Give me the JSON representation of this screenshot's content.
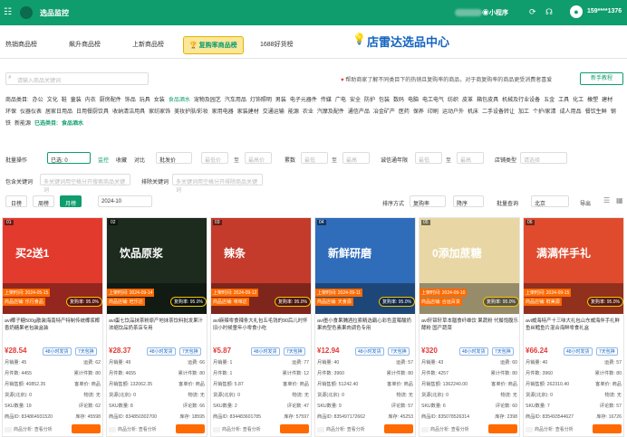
{
  "topbar": {
    "title": "选品监控",
    "mini_program": "小程序",
    "phone": "159****1376",
    "color": "#0f9d6e"
  },
  "tabs": [
    {
      "label": "热销商品榜"
    },
    {
      "label": "飙升商品榜"
    },
    {
      "label": "上新商品榜"
    },
    {
      "label": "复购率商品榜",
      "active": true
    },
    {
      "label": "1688好货榜"
    }
  ],
  "brand_text": "店雷达选品中心",
  "search": {
    "placeholder": "请输入商品关键词"
  },
  "notice": {
    "prefix": "帮助商家了解不同类目下的热销且复购率的商品，对于商复购率的商品更受消费者喜爱"
  },
  "tutor_button": "新手教程",
  "categories": {
    "label": "商品类目:",
    "items": [
      "办公",
      "文化",
      "鞋",
      "童装",
      "内衣",
      "厨房配件",
      "饰品",
      "玩具",
      "女装",
      "食品酒水",
      "宠物及园艺",
      "汽车用品",
      "灯饰照明",
      "男装",
      "电子元器件",
      "传媒",
      "广电",
      "安全",
      "防护",
      "包装",
      "数码",
      "电脑",
      "电工电气",
      "纺织",
      "皮革",
      "箱包皮具",
      "机械及行业设备",
      "五金",
      "工具",
      "化工",
      "橡塑",
      "建材",
      "环保",
      "仪器仪表",
      "居家日用品",
      "日用餐厨饮具",
      "收纳清洁用具",
      "家纺家饰",
      "美妆护肤/彩妆",
      "家用电器",
      "家装建材",
      "交通运输",
      "能源",
      "农业",
      "汽摩及配件",
      "通信产品",
      "冶金矿产",
      "医药",
      "保养",
      "印刷",
      "运动户外",
      "机床",
      "二手设备转让",
      "加工",
      "个护/家清",
      "成人用品",
      "餐饮生鲜",
      "钢铁",
      "新能源"
    ],
    "current_label": "已选类目:",
    "current_value": "食品酒水"
  },
  "filters": {
    "batch_label": "批量操作",
    "selected_box": "已选: 0",
    "btn_monitor": "监控",
    "btn_collect": "收藏",
    "btn_compare": "对比",
    "batch_sel": "批发价",
    "min_price": "最低价",
    "to": "至",
    "max_price": "最高价",
    "deal_label": "订单量(近30天)",
    "min_deal": "最低",
    "max_deal": "最高",
    "score_label": "累数",
    "min_score": "最低",
    "max_score": "最高",
    "tenure_label": "诚信通年限",
    "min_ten": "最低",
    "max_ten": "最高",
    "shop_type_label": "店铺类型",
    "shop_type_sel": "请选择",
    "include_label": "包含关键词",
    "include_ph": "多关键词用空格分开搜索商品关键词",
    "exclude_label": "排除关键词",
    "exclude_ph": "多关键词用空格分开排除商品关键词"
  },
  "period": {
    "daily": "日榜",
    "weekly": "周榜",
    "monthly": "月榜",
    "month_value": "2024-10",
    "sort_label": "排序方式",
    "sort_value": "复购率",
    "order_value": "降序",
    "batch_query": "批量查询",
    "region": "北京",
    "export": "导出"
  },
  "products": [
    {
      "num": "01",
      "img_color": "#e23b2e",
      "img_word": "买2送1",
      "date": "上架时间: 2024-05-15",
      "shop": "商品店铺: 乐行食品",
      "rate": "复购率: 95.0%",
      "title": "avi椰子糖500g散装海南特产特制传统椰浆椰香奶糖果老包装盒装",
      "price": "¥28.54",
      "tag1": "48小时发货",
      "tag2": "7天包换",
      "rows": [
        [
          "月销量: 45",
          "运费: 62"
        ],
        [
          "月件数: 4455",
          "累计件数: 80"
        ],
        [
          "月销售额: 40852.35",
          "客单价: 商品"
        ],
        [
          "货源(北京): 0",
          "物流: 无"
        ],
        [
          "SKU数量: 19",
          "评论数: 62"
        ],
        [
          "商品ID: 834864931520",
          "库存: 45598"
        ]
      ],
      "foot": "商品分析: 查看分析"
    },
    {
      "num": "02",
      "img_color": "#1d2a1e",
      "img_word": "饮品原浆",
      "date": "上架时间: 2024-09-14",
      "shop": "商品店铺: 旺乐达",
      "rate": "复购率: 95.0%",
      "title": "avi蛋七饮品抹茶粉原产地抹茶饮料批发果汁浓缩饮品奶茶店专用",
      "price": "¥28.37",
      "tag1": "48小时发货",
      "tag2": "7天包换",
      "rows": [
        [
          "月销量: 49",
          "运费: 66"
        ],
        [
          "月件数: 4655",
          "累计件数: 80"
        ],
        [
          "月销售额: 132062.35",
          "客单价: 商品"
        ],
        [
          "货源(北京): 0",
          "物流: 无"
        ],
        [
          "SKU数量: 8",
          "评论数: 66"
        ],
        [
          "商品ID: 834850302700",
          "库存: 18595"
        ]
      ],
      "foot": "商品分析: 查看分析"
    },
    {
      "num": "03",
      "img_color": "#c43b2c",
      "img_word": "辣条",
      "date": "上架时间: 2024-09-12",
      "shop": "商品店铺: 味味达",
      "rate": "复购率: 95.0%",
      "title": "avi麻辣零食辣条大礼包五毛钱的90后儿时怀旧小时候童年小零食小吃",
      "price": "¥5.87",
      "tag1": "48小时发货",
      "tag2": "7天包换",
      "rows": [
        [
          "月销量: 1",
          "运费: 77"
        ],
        [
          "月件数: 1",
          "累计件数: 12"
        ],
        [
          "月销售额: 5.87",
          "客单价: 商品"
        ],
        [
          "货源(北京): 0",
          "物流: 无"
        ],
        [
          "SKU数量: 2",
          "评论数: 47"
        ],
        [
          "商品ID: 834483601785",
          "库存: 57597"
        ]
      ],
      "foot": "商品分析: 查看分析"
    },
    {
      "num": "04",
      "img_color": "#2f6dbb",
      "img_word": "新鲜研磨",
      "date": "上架时间: 2024-09-11",
      "shop": "商品店铺: 天食源",
      "rate": "复购率: 95.0%",
      "title": "avi墨小食果脯酒拉索精选霸心彩色蓝莓酸奶果肉型色素果肉调色专用",
      "price": "¥12.94",
      "tag1": "48小时发货",
      "tag2": "7天包换",
      "rows": [
        [
          "月销量: 40",
          "运费: 57"
        ],
        [
          "月件数: 3960",
          "累计件数: 80"
        ],
        [
          "月销售额: 51242.40",
          "客单价: 商品"
        ],
        [
          "货源(北京): 0",
          "物流: 无"
        ],
        [
          "SKU数量: 9",
          "评论数: 57"
        ],
        [
          "商品ID: 835497172662",
          "库存: 45253"
        ]
      ],
      "foot": "商品分析: 查看分析"
    },
    {
      "num": "05",
      "img_color": "#e8d7a4",
      "img_word": "0添加蔗糖",
      "date": "上架时间: 2024-09-10",
      "shop": "商品店铺: 合运百货",
      "rate": "复购率: 95.0%",
      "title": "avi轩锦轩草本膳食纤维饮 果蔬粉 代餐饱腹乐酵粉 国产蔬菜",
      "price": "¥320",
      "tag1": "48小时发货",
      "tag2": "7天包换",
      "rows": [
        [
          "月销量: 43",
          "运费: 60"
        ],
        [
          "月件数: 4257",
          "累计件数: 80"
        ],
        [
          "月销售额: 1362240.00",
          "客单价: 商品"
        ],
        [
          "货源(北京): 0",
          "物流: 无"
        ],
        [
          "SKU数量: 6",
          "评论数: 60"
        ],
        [
          "商品ID: 835078526314",
          "库存: 2398"
        ]
      ],
      "foot": "商品分析: 查看分析"
    },
    {
      "num": "06",
      "img_color": "#e04b2e",
      "img_word": "满满伴手礼",
      "date": "上架时间: 2024-09-15",
      "shop": "商品店铺: 鲜美源",
      "rate": "复购率: 95.0%",
      "title": "avi威海特产十三味大礼包山东威海伴手礼鲜鱼丝鳕鱼片混合海鲜零食礼盒",
      "price": "¥66.24",
      "tag1": "48小时发货",
      "tag2": "7天包换",
      "rows": [
        [
          "月销量: 40",
          "运费: 57"
        ],
        [
          "月件数: 3960",
          "累计件数: 80"
        ],
        [
          "月销售额: 262310.40",
          "客单价: 商品"
        ],
        [
          "货源(北京): 0",
          "物流: 无"
        ],
        [
          "SKU数量: 7",
          "评论数: 57"
        ],
        [
          "商品ID: 835493544627",
          "库存: 16726"
        ]
      ],
      "foot": "商品分析: 查看分析"
    }
  ]
}
